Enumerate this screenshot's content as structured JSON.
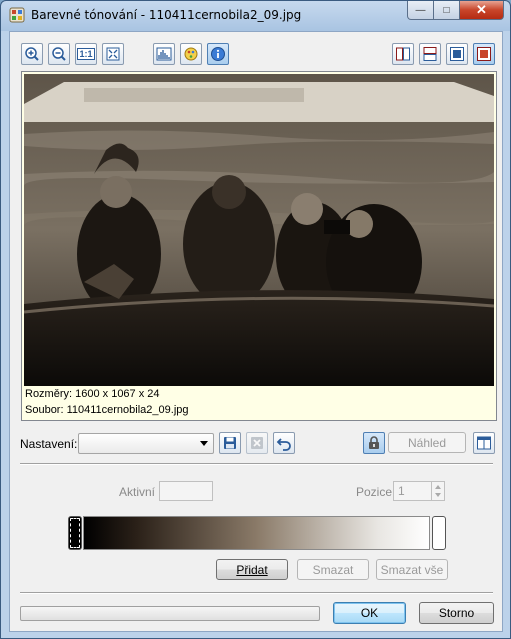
{
  "window": {
    "title": "Barevné tónování - 110411cernobila2_09.jpg",
    "close_glyph": "✕",
    "max_glyph": "□",
    "min_glyph": "—"
  },
  "toolbar": {
    "left_icons": [
      "zoom-in-icon",
      "zoom-out-icon",
      "actual-size-icon",
      "fit-to-window-icon",
      "histogram-icon",
      "color-palette-icon",
      "info-icon"
    ],
    "right_icons": [
      "split-vertical-icon",
      "split-horizontal-icon",
      "single-view-icon",
      "original-view-icon"
    ],
    "actual_size_label": "1:1"
  },
  "preview": {
    "dimensions_text": "Rozměry: 1600 x 1067 x 24",
    "file_text": "Soubor: 110411cernobila2_09.jpg"
  },
  "settings": {
    "label": "Nastavení:",
    "value": "",
    "preview_button": "Náhled"
  },
  "gradient_editor": {
    "active_label": "Aktivní",
    "active_value": "",
    "position_label": "Pozice",
    "position_value": "1",
    "add_button": "Přidat",
    "delete_button": "Smazat",
    "delete_all_button": "Smazat vše"
  },
  "footer": {
    "ok_button": "OK",
    "cancel_button": "Storno"
  },
  "colors": {
    "accent": "#3c7fb1",
    "photo_tint": "#2a2018"
  }
}
